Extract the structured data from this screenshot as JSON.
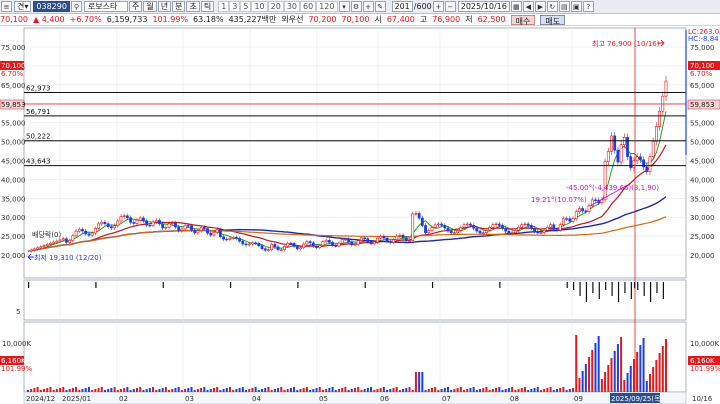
{
  "toolbar": {
    "menu_icon": "menu-icon",
    "view_select": "견",
    "code": "038290",
    "name": "로보스타",
    "periods": [
      "주",
      "월",
      "년",
      "분",
      "초",
      "틱"
    ],
    "numbers": [
      "1",
      "3",
      "5",
      "10",
      "20",
      "30",
      "60",
      "120"
    ],
    "count": "201",
    "total": "/600",
    "date": "2025/10/16"
  },
  "info": {
    "price": "70,100",
    "change": "4,400",
    "change_pct": "+6.70%",
    "volume": "6,159,733",
    "vol_ratio": "101.99%",
    "turnover": "63.18%",
    "amount": "435,227백만",
    "preferred": "외우선",
    "pref_price": "70,200",
    "price2": "70,100",
    "open_label": "시",
    "open": "67,400",
    "high_label": "고",
    "high": "76,900",
    "low_label": "저",
    "low": "62,500",
    "buy": "매수",
    "sell": "매도"
  },
  "chart": {
    "y_ticks": [
      "75,000",
      "70,000",
      "65,000",
      "60,000",
      "55,000",
      "50,000",
      "45,000",
      "40,000",
      "35,000",
      "30,000",
      "25,000",
      "20,000"
    ],
    "x_labels": [
      "2024/12",
      "2025/01",
      "02",
      "03",
      "04",
      "05",
      "06",
      "07",
      "08",
      "09",
      "10/16"
    ],
    "h_lines": [
      "62,973",
      "56,791",
      "50,222",
      "43,643"
    ],
    "current_left": "59,853",
    "current_right": "59,853",
    "price_tag_left": "70,100",
    "price_tag_right": "70,100",
    "pct_left": "6.70%",
    "pct_right": "6.70%",
    "high_note": "최고 76,900 (10/16)",
    "low_note": "최저 19,310 (12/20)",
    "ex_div_note": "배당락(0)",
    "annot_1": "-45.00°(-4,439.66)(3,1,90)",
    "annot_2": "19.21°(10.07%)",
    "lc": "LC:263.02",
    "hc": "HC:-8.84",
    "sub_tick_5": "5",
    "vol_tick": "10,000K",
    "vol_tag": "6,160K",
    "vol_pct": "101.99%",
    "cursor_date": "2025/09/25(목)",
    "colors": {
      "up": "#e0191c",
      "down": "#1c3fe0",
      "ma5": "#2a9d2a",
      "ma20": "#c0171b",
      "ma60": "#1a2aa8",
      "ma120": "#d36a10"
    }
  }
}
